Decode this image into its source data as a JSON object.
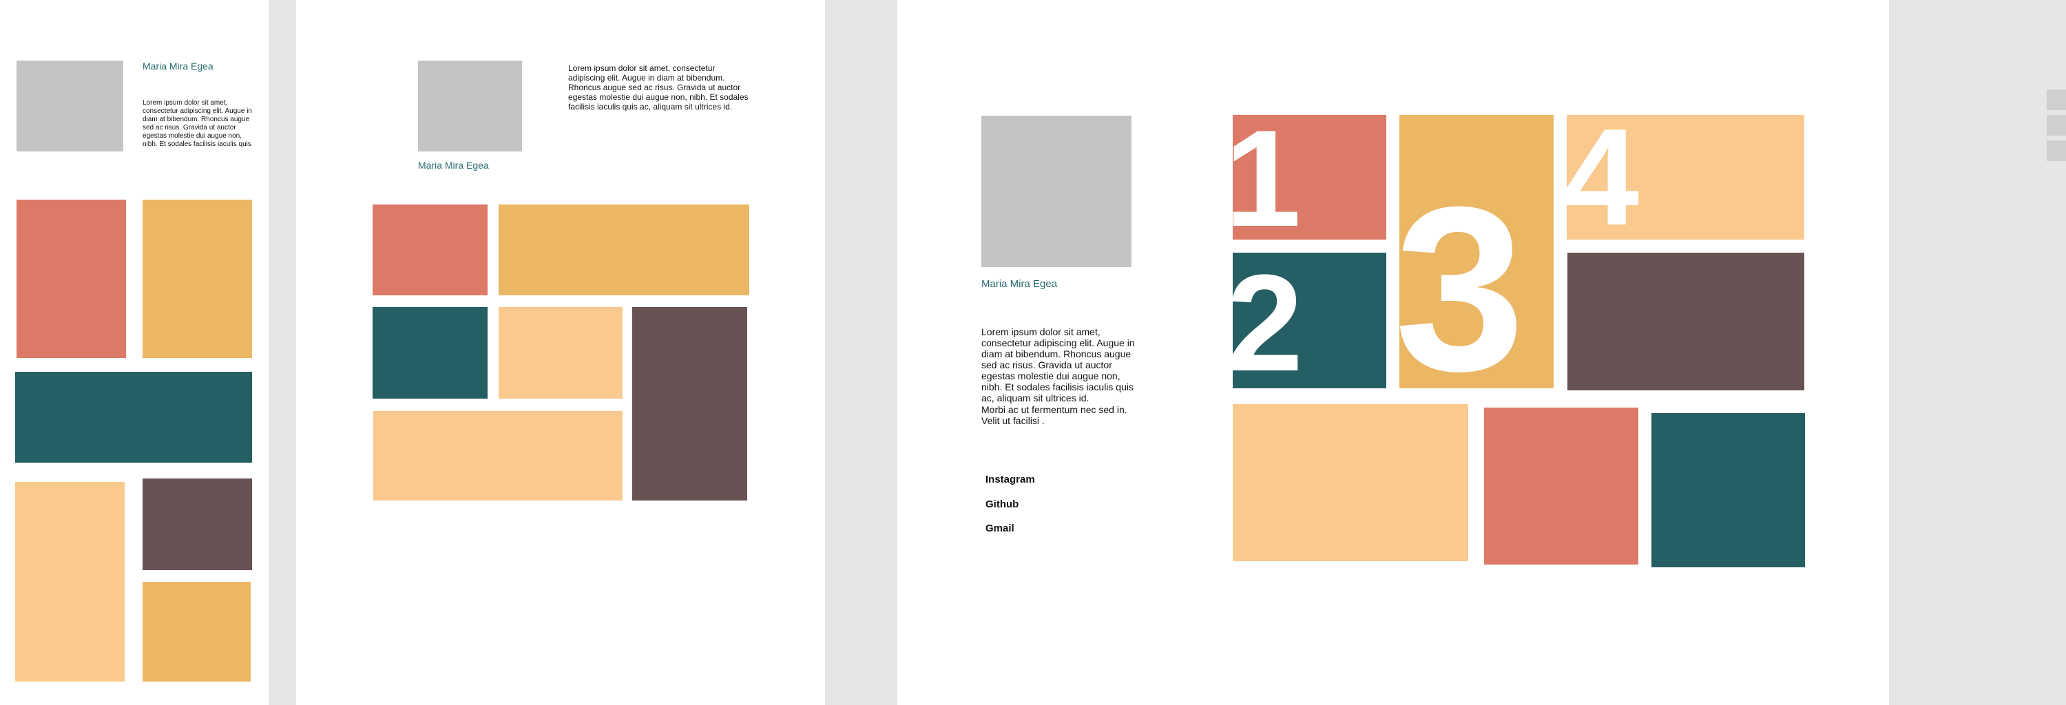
{
  "profile": {
    "name": "Maria Mira Egea",
    "lorem_short": "Lorem ipsum dolor sit amet, consectetur adipiscing elit. Augue in diam at bibendum. Rhoncus augue sed ac risus. Gravida ut auctor egestas molestie dui augue non, nibh. Et sodales facilisis iaculis quis",
    "lorem_medium": "Lorem ipsum dolor sit amet, consectetur adipiscing elit. Augue in diam at bibendum. Rhoncus augue sed ac risus. Gravida ut auctor egestas molestie dui augue non, nibh. Et sodales facilisis iaculis quis ac, aliquam sit ultrices id.",
    "lorem_long": "Lorem ipsum dolor sit amet, consectetur adipiscing elit. Augue in diam at bibendum. Rhoncus augue sed ac risus. Gravida ut auctor egestas molestie dui augue non, nibh. Et sodales facilisis iaculis quis ac, aliquam sit ultrices id.",
    "lorem_extra": "Morbi ac ut fermentum nec sed in. Velit ut facilisi ."
  },
  "links": {
    "instagram": "Instagram",
    "github": "Github",
    "gmail": "Gmail"
  },
  "numbers": {
    "one": "1",
    "two": "2",
    "three": "3",
    "four": "4"
  },
  "colors": {
    "coral": "#dd7a67",
    "yellow": "#ebb765",
    "teal": "#255f63",
    "peach": "#f9c98e",
    "brown": "#685253",
    "placeholder": "#c4c4c4",
    "name_text": "#2a6b70",
    "canvas": "#e6e6e6"
  }
}
